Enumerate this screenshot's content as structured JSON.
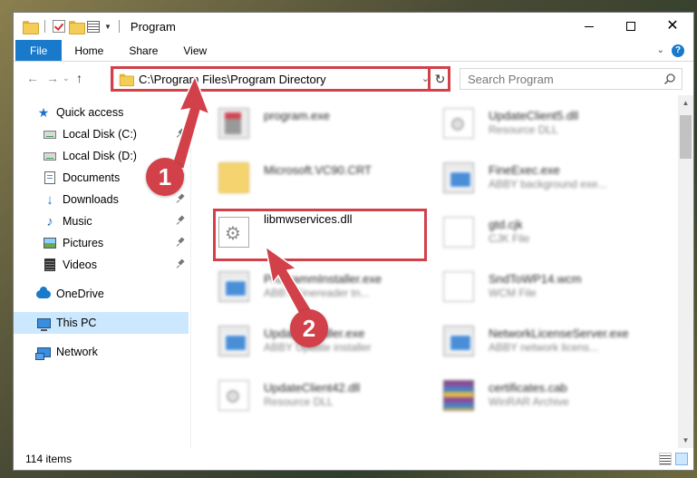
{
  "window": {
    "title": "Program"
  },
  "ribbon": {
    "tabs": [
      {
        "label": "File"
      },
      {
        "label": "Home"
      },
      {
        "label": "Share"
      },
      {
        "label": "View"
      }
    ],
    "help_label": "?"
  },
  "address": {
    "path": "C:\\Program Files\\Program Directory"
  },
  "search": {
    "placeholder": "Search Program"
  },
  "sidebar": {
    "items": [
      {
        "label": "Quick access",
        "icon": "star-icon"
      },
      {
        "label": "Local Disk (C:)",
        "icon": "drive-icon"
      },
      {
        "label": "Local Disk (D:)",
        "icon": "drive-icon"
      },
      {
        "label": "Documents",
        "icon": "documents-icon"
      },
      {
        "label": "Downloads",
        "icon": "downloads-icon"
      },
      {
        "label": "Music",
        "icon": "music-icon"
      },
      {
        "label": "Pictures",
        "icon": "pictures-icon"
      },
      {
        "label": "Videos",
        "icon": "videos-icon"
      },
      {
        "label": "OneDrive",
        "icon": "onedrive-icon"
      },
      {
        "label": "This PC",
        "icon": "computer-icon"
      },
      {
        "label": "Network",
        "icon": "network-icon"
      }
    ]
  },
  "files": [
    {
      "name": "program.exe",
      "sub": ""
    },
    {
      "name": "UpdateClient5.dll",
      "sub": "Resource DLL"
    },
    {
      "name": "Microsoft.VC90.CRT",
      "sub": ""
    },
    {
      "name": "FineExec.exe",
      "sub": "ABBY background exe..."
    },
    {
      "name": "libmwservices.dll",
      "sub": ""
    },
    {
      "name": "gtd.cjk",
      "sub": "CJK File"
    },
    {
      "name": "ProgrammInstaller.exe",
      "sub": "ABBY Finereader tn..."
    },
    {
      "name": "SndToWP14.wcm",
      "sub": "WCM File"
    },
    {
      "name": "UpdateInstaller.exe",
      "sub": "ABBY Update installer"
    },
    {
      "name": "NetworkLicenseServer.exe",
      "sub": "ABBY network licens..."
    },
    {
      "name": "UpdateClient42.dll",
      "sub": "Resource DLL"
    },
    {
      "name": "certificates.cab",
      "sub": "WinRAR Archive"
    }
  ],
  "markers": {
    "first": "1",
    "second": "2"
  },
  "status": {
    "item_count": "114 items"
  },
  "colors": {
    "accent": "#1979ca",
    "highlight": "#d2404a",
    "selection": "#cce8ff"
  }
}
